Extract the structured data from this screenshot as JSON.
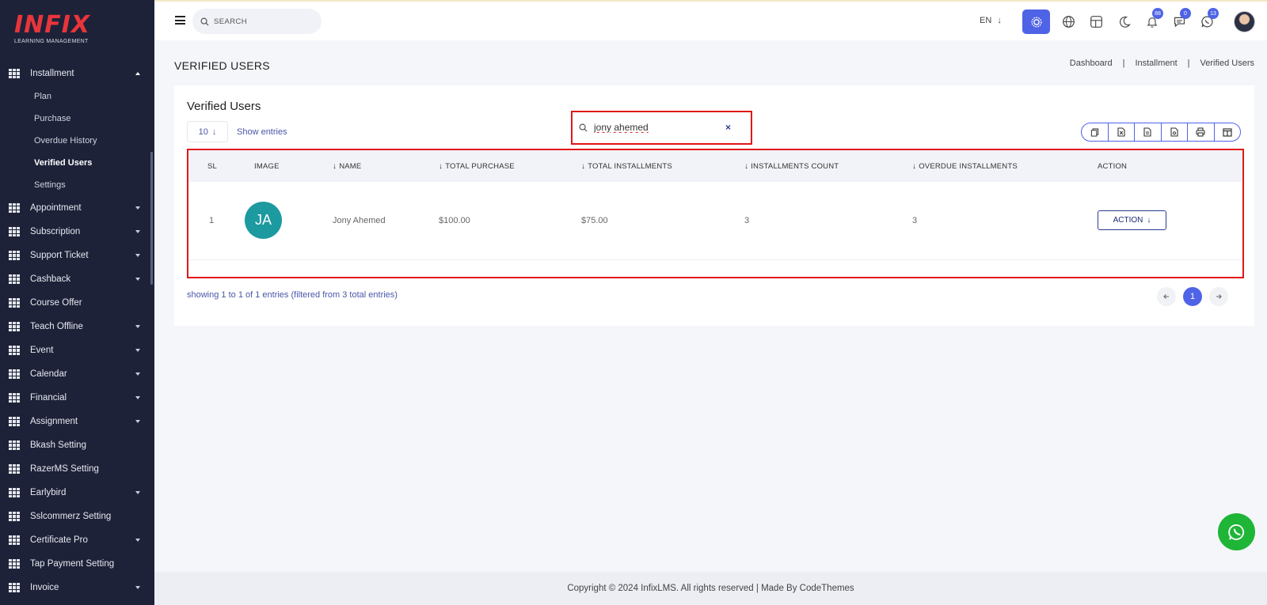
{
  "brand": {
    "logo_text": "INFIX",
    "logo_sub": "LEARNING MANAGEMENT"
  },
  "sidebar": {
    "items": [
      {
        "label": "Installment",
        "expanded": true,
        "has_caret": true,
        "children": [
          {
            "label": "Plan"
          },
          {
            "label": "Purchase"
          },
          {
            "label": "Overdue History"
          },
          {
            "label": "Verified Users",
            "active": true
          },
          {
            "label": "Settings"
          }
        ]
      },
      {
        "label": "Appointment",
        "has_caret": true
      },
      {
        "label": "Subscription",
        "has_caret": true
      },
      {
        "label": "Support Ticket",
        "has_caret": true
      },
      {
        "label": "Cashback",
        "has_caret": true
      },
      {
        "label": "Course Offer",
        "has_caret": false
      },
      {
        "label": "Teach Offline",
        "has_caret": true
      },
      {
        "label": "Event",
        "has_caret": true
      },
      {
        "label": "Calendar",
        "has_caret": true
      },
      {
        "label": "Financial",
        "has_caret": true
      },
      {
        "label": "Assignment",
        "has_caret": true
      },
      {
        "label": "Bkash Setting",
        "has_caret": false
      },
      {
        "label": "RazerMS Setting",
        "has_caret": false
      },
      {
        "label": "Earlybird",
        "has_caret": true
      },
      {
        "label": "Sslcommerz Setting",
        "has_caret": false
      },
      {
        "label": "Certificate Pro",
        "has_caret": true
      },
      {
        "label": "Tap Payment Setting",
        "has_caret": false
      },
      {
        "label": "Invoice",
        "has_caret": true
      }
    ]
  },
  "topbar": {
    "search_placeholder": "SEARCH",
    "language": "EN",
    "badges": {
      "notifications": "88",
      "messages": "0",
      "whatsapp": "13"
    }
  },
  "page": {
    "title": "VERIFIED USERS",
    "breadcrumb": [
      "Dashboard",
      "Installment",
      "Verified Users"
    ]
  },
  "card": {
    "title": "Verified Users",
    "entries_value": "10",
    "show_entries_label": "Show entries",
    "filter_value": "jony ahemed",
    "clear_symbol": "×",
    "table": {
      "columns": [
        "SL",
        "IMAGE",
        "NAME",
        "TOTAL PURCHASE",
        "TOTAL INSTALLMENTS",
        "INSTALLMENTS COUNT",
        "OVERDUE INSTALLMENTS",
        "ACTION"
      ],
      "rows": [
        {
          "sl": "1",
          "initials": "JA",
          "name": "Jony Ahemed",
          "total_purchase": "$100.00",
          "total_installments": "$75.00",
          "installments_count": "3",
          "overdue_installments": "3",
          "action_label": "ACTION"
        }
      ]
    },
    "showing_text": "showing 1 to 1 of 1 entries (filtered from 3 total entries)",
    "pagination": {
      "current": "1"
    }
  },
  "footer": {
    "text": "Copyright © 2024 InfixLMS. All rights reserved | Made By CodeThemes"
  },
  "colors": {
    "sidebar_bg": "#1d2238",
    "accent": "#4f63e6",
    "highlight": "#e01818",
    "avatar_bg": "#1c9aa0",
    "whatsapp": "#1fb537"
  }
}
